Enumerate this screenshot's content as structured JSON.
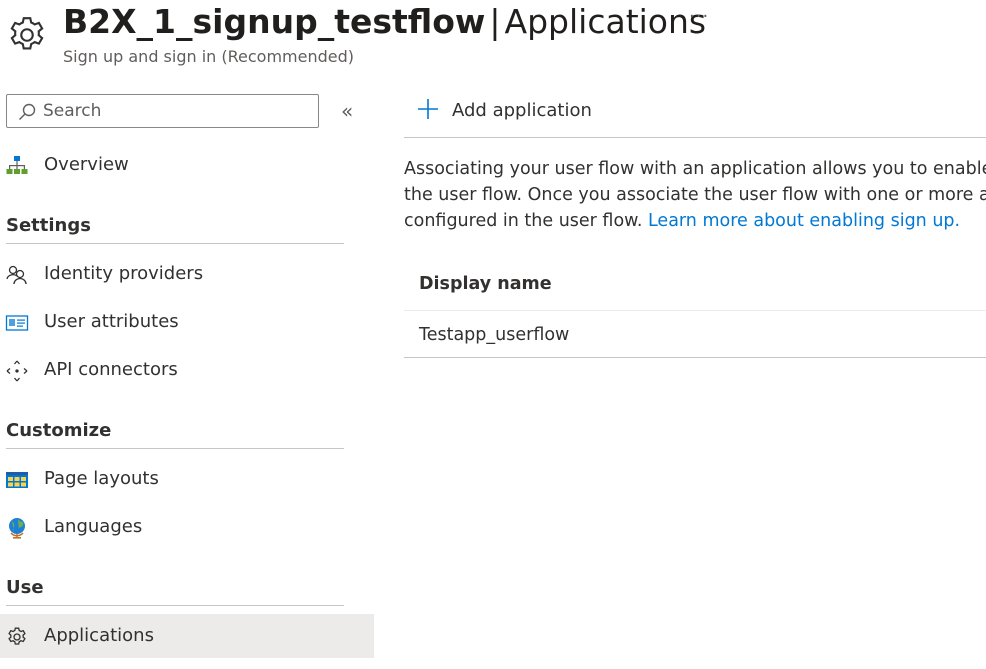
{
  "header": {
    "title_bold": "B2X_1_signup_testflow",
    "title_sep": "|",
    "title_rest": "Applications",
    "subtitle": "Sign up and sign in (Recommended)",
    "more": "···",
    "icon": "gear-icon"
  },
  "sidebar": {
    "search_placeholder": "Search",
    "collapse": "«",
    "overview": {
      "label": "Overview",
      "icon": "hierarchy-icon"
    },
    "sections": [
      {
        "title": "Settings",
        "items": [
          {
            "label": "Identity providers",
            "icon": "people-icon"
          },
          {
            "label": "User attributes",
            "icon": "id-card-icon"
          },
          {
            "label": "API connectors",
            "icon": "arrows-icon"
          }
        ]
      },
      {
        "title": "Customize",
        "items": [
          {
            "label": "Page layouts",
            "icon": "layout-icon"
          },
          {
            "label": "Languages",
            "icon": "globe-icon"
          }
        ]
      },
      {
        "title": "Use",
        "items": [
          {
            "label": "Applications",
            "icon": "gear-icon",
            "active": true
          }
        ]
      }
    ]
  },
  "main": {
    "add_button": "Add application",
    "description": {
      "line1": "Associating your user flow with an application allows you to enable s",
      "line2": "the user flow. Once you associate the user flow with one or more ap",
      "line3_text": "configured in the user flow. ",
      "line3_link": "Learn more about enabling sign up."
    },
    "table": {
      "columns": [
        "Display name"
      ],
      "rows": [
        [
          "Testapp_userflow"
        ]
      ]
    }
  },
  "colors": {
    "accent": "#0078d4",
    "active_bg": "#edebe9",
    "text": "#323130"
  }
}
